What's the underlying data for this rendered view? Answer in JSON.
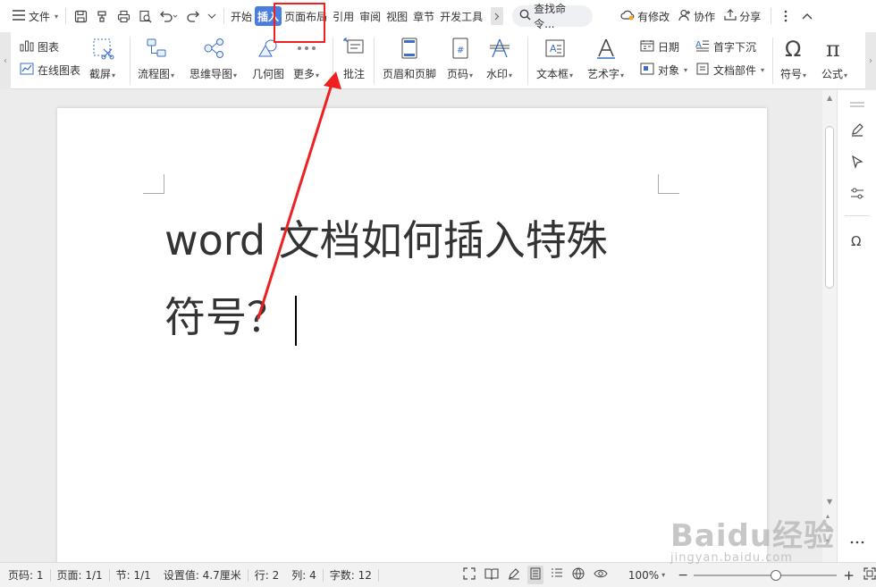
{
  "menubar": {
    "file_label": "文件",
    "tabs": [
      "开始",
      "插入",
      "页面布局",
      "引用",
      "审阅",
      "视图",
      "章节",
      "开发工具"
    ],
    "active_tab": "插入",
    "search_placeholder": "查找命令...",
    "modified_label": "有修改",
    "collab_label": "协作",
    "share_label": "分享"
  },
  "ribbon": {
    "chart": "图表",
    "online_chart": "在线图表",
    "screenshot": "截屏",
    "flowchart": "流程图",
    "mindmap": "思维导图",
    "geometry": "几何图",
    "more": "更多",
    "comment": "批注",
    "header_footer": "页眉和页脚",
    "page_number": "页码",
    "watermark": "水印",
    "textbox": "文本框",
    "wordart": "艺术字",
    "date": "日期",
    "object": "对象",
    "dropcap": "首字下沉",
    "doc_parts": "文档部件",
    "symbol": "符号",
    "formula": "公式"
  },
  "document": {
    "line1": "word 文档如何插入特殊",
    "line2": "符号？"
  },
  "statusbar": {
    "page_num": "页码: 1",
    "page": "页面: 1/1",
    "section": "节: 1/1",
    "setting": "设置值: 4.7厘米",
    "row": "行: 2",
    "col": "列: 4",
    "word_count": "字数: 12",
    "zoom": "100%"
  },
  "watermark": {
    "main": "Baidu经验",
    "sub": "jingyan.baidu.com"
  },
  "colors": {
    "accent": "#4a7de0",
    "annotation": "#f02020"
  }
}
